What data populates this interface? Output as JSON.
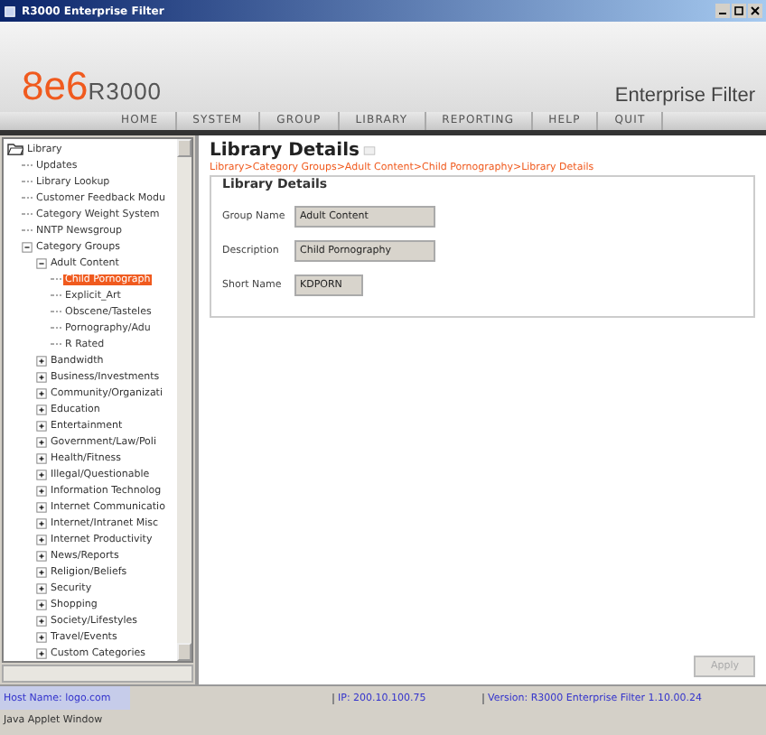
{
  "window": {
    "title": "R3000 Enterprise Filter"
  },
  "header": {
    "logo_brand": "8e6",
    "logo_product": "R3000",
    "product_name": "Enterprise Filter"
  },
  "nav": [
    {
      "label": "HOME"
    },
    {
      "label": "SYSTEM"
    },
    {
      "label": "GROUP"
    },
    {
      "label": "LIBRARY"
    },
    {
      "label": "REPORTING"
    },
    {
      "label": "HELP"
    },
    {
      "label": "QUIT"
    }
  ],
  "tree": {
    "items": [
      {
        "label": "Library",
        "kind": "root",
        "expanded": true,
        "children": [
          {
            "label": "Updates",
            "kind": "leaf",
            "selected": false
          },
          {
            "label": "Library Lookup",
            "kind": "leaf",
            "selected": false
          },
          {
            "label": "Customer Feedback Modu",
            "kind": "leaf",
            "selected": false
          },
          {
            "label": "Category Weight System",
            "kind": "leaf",
            "selected": false
          },
          {
            "label": "NNTP Newsgroup",
            "kind": "leaf",
            "selected": false
          },
          {
            "label": "Category Groups",
            "kind": "group",
            "expanded": true,
            "children": [
              {
                "label": "Adult Content",
                "kind": "group",
                "expanded": true,
                "children": [
                  {
                    "label": "Child Pornograph",
                    "kind": "leaf",
                    "selected": true
                  },
                  {
                    "label": "Explicit_Art",
                    "kind": "leaf",
                    "selected": false
                  },
                  {
                    "label": "Obscene/Tasteles",
                    "kind": "leaf",
                    "selected": false
                  },
                  {
                    "label": "Pornography/Adu",
                    "kind": "leaf",
                    "selected": false
                  },
                  {
                    "label": "R Rated",
                    "kind": "leaf",
                    "selected": false
                  }
                ]
              },
              {
                "label": "Bandwidth",
                "kind": "group",
                "expanded": false
              },
              {
                "label": "Business/Investments",
                "kind": "group",
                "expanded": false
              },
              {
                "label": "Community/Organizati",
                "kind": "group",
                "expanded": false
              },
              {
                "label": "Education",
                "kind": "group",
                "expanded": false
              },
              {
                "label": "Entertainment",
                "kind": "group",
                "expanded": false
              },
              {
                "label": "Government/Law/Poli",
                "kind": "group",
                "expanded": false
              },
              {
                "label": "Health/Fitness",
                "kind": "group",
                "expanded": false
              },
              {
                "label": "Illegal/Questionable",
                "kind": "group",
                "expanded": false
              },
              {
                "label": "Information Technolog",
                "kind": "group",
                "expanded": false
              },
              {
                "label": "Internet Communicatio",
                "kind": "group",
                "expanded": false
              },
              {
                "label": "Internet/Intranet Misc",
                "kind": "group",
                "expanded": false
              },
              {
                "label": "Internet Productivity",
                "kind": "group",
                "expanded": false
              },
              {
                "label": "News/Reports",
                "kind": "group",
                "expanded": false
              },
              {
                "label": "Religion/Beliefs",
                "kind": "group",
                "expanded": false
              },
              {
                "label": "Security",
                "kind": "group",
                "expanded": false
              },
              {
                "label": "Shopping",
                "kind": "group",
                "expanded": false
              },
              {
                "label": "Society/Lifestyles",
                "kind": "group",
                "expanded": false
              },
              {
                "label": "Travel/Events",
                "kind": "group",
                "expanded": false
              },
              {
                "label": "Custom Categories",
                "kind": "group",
                "expanded": false
              }
            ]
          }
        ]
      }
    ]
  },
  "content": {
    "title": "Library Details",
    "breadcrumb": "Library>Category Groups>Adult Content>Child Pornography>Library Details",
    "panel": {
      "title": "Library Details",
      "fields": [
        {
          "label": "Group Name",
          "value": "Adult Content"
        },
        {
          "label": "Description",
          "value": "Child Pornography"
        },
        {
          "label": "Short Name",
          "value": "KDPORN"
        }
      ]
    },
    "apply_button": {
      "label": "Apply",
      "disabled": true
    }
  },
  "status_bar": {
    "host": "Host Name: logo.com",
    "ip": "IP: 200.10.100.75",
    "version": "Version: R3000 Enterprise Filter 1.10.00.24"
  },
  "footer": "Java Applet Window"
}
